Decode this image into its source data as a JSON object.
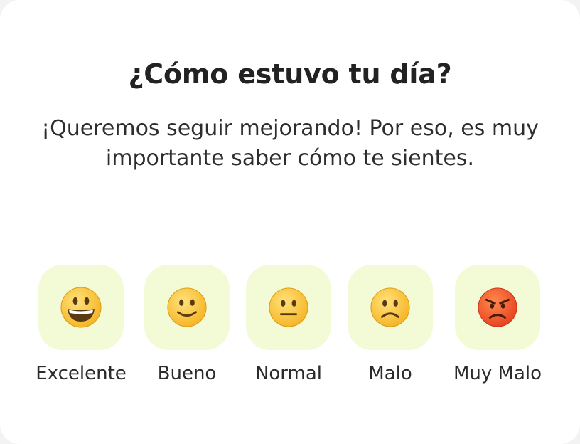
{
  "survey": {
    "title": "¿Cómo estuvo tu día?",
    "subtitle": "¡Queremos seguir mejorando! Por eso, es muy importante saber cómo te sientes.",
    "options": [
      {
        "label": "Excelente",
        "icon": "grinning-face-icon"
      },
      {
        "label": "Bueno",
        "icon": "slightly-smiling-face-icon"
      },
      {
        "label": "Normal",
        "icon": "neutral-face-icon"
      },
      {
        "label": "Malo",
        "icon": "slightly-frowning-face-icon"
      },
      {
        "label": "Muy Malo",
        "icon": "angry-face-icon"
      }
    ]
  },
  "colors": {
    "tile_background": "#f3fad6",
    "emoji_yellow": "#ffc83d",
    "emoji_angry": "#f4592e"
  }
}
